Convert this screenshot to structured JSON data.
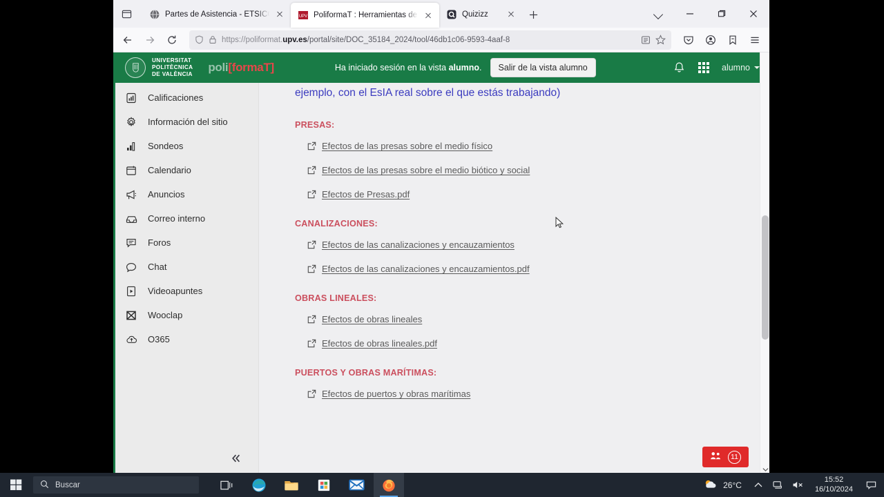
{
  "browser": {
    "tab_list_icon": "tab-list-icon",
    "tabs": [
      {
        "title": "Partes de Asistencia - ETSICCP",
        "favicon": "globe-icon",
        "active": false
      },
      {
        "title": "PoliformaT : Herramientas de e",
        "favicon": "upv-icon",
        "active": true
      },
      {
        "title": "Quizizz",
        "favicon": "quizizz-icon",
        "active": false
      }
    ],
    "new_tab_label": "+",
    "window_controls": {
      "list_all_tabs": "chevron-down-icon",
      "minimize": "—",
      "maximize": "❐",
      "close": "✕"
    },
    "nav": {
      "back": "back-arrow-icon",
      "forward": "forward-arrow-icon",
      "reload": "reload-icon",
      "url_prefix": "https://poliformat.",
      "url_domain": "upv.es",
      "url_path": "/portal/site/DOC_35184_2024/tool/46db1c06-9593-4aaf-8",
      "reader_icon": "reader-view-icon",
      "bookmark_icon": "star-icon",
      "shield_icon": "shield-icon",
      "lock_icon": "lock-icon",
      "pocket_icon": "pocket-icon",
      "account_icon": "account-icon",
      "save_to_pocket_icon": "save-icon",
      "menu_icon": "hamburger-menu-icon"
    }
  },
  "site_header": {
    "university_lines": [
      "UNIVERSITAT",
      "POLITÈCNICA",
      "DE VALÈNCIA"
    ],
    "logo_poli": "poli",
    "logo_format": "[formaT]",
    "session_message_pre": "Ha iniciado sesión en la vista ",
    "session_message_role": "alumno",
    "session_message_post": ".",
    "exit_button": "Salir de la vista alumno",
    "bell_icon": "bell-icon",
    "grid_icon": "app-grid-icon",
    "user_name": "alumno",
    "brand_green": "#197b46",
    "brand_red": "#e8464a"
  },
  "sidebar": {
    "items": [
      {
        "label": "Calificaciones",
        "icon": "grades-chart-icon"
      },
      {
        "label": "Información del sitio",
        "icon": "gear-icon"
      },
      {
        "label": "Sondeos",
        "icon": "bar-chart-icon"
      },
      {
        "label": "Calendario",
        "icon": "calendar-icon"
      },
      {
        "label": "Anuncios",
        "icon": "megaphone-icon"
      },
      {
        "label": "Correo interno",
        "icon": "inbox-icon"
      },
      {
        "label": "Foros",
        "icon": "forum-icon"
      },
      {
        "label": "Chat",
        "icon": "chat-bubble-icon"
      },
      {
        "label": "Videoapuntes",
        "icon": "video-file-icon"
      },
      {
        "label": "Wooclap",
        "icon": "wooclap-icon"
      },
      {
        "label": "O365",
        "icon": "cloud-upload-icon"
      }
    ],
    "collapse_icon": "double-chevron-left-icon"
  },
  "content": {
    "intro_line": "ejemplo, con el EsIA real sobre el que estás trabajando)",
    "sections": [
      {
        "heading": "PRESAS:",
        "links": [
          "Efectos de las presas sobre el medio físico",
          "Efectos de las presas sobre el medio biótico y social",
          "Efectos de Presas.pdf"
        ]
      },
      {
        "heading": "CANALIZACIONES:",
        "links": [
          "Efectos de las canalizaciones y encauzamientos",
          "Efectos de las canalizaciones y encauzamientos.pdf"
        ]
      },
      {
        "heading": "OBRAS LINEALES:",
        "links": [
          "Efectos de obras lineales",
          "Efectos de obras lineales.pdf"
        ]
      },
      {
        "heading": "PUERTOS Y OBRAS MARÍTIMAS:",
        "links": [
          "Efectos de puertos y obras marítimas"
        ]
      }
    ],
    "heading_color": "#cb4f5e",
    "intro_color": "#3b3bbf",
    "external_link_icon": "external-link-icon"
  },
  "participants_badge": {
    "icon": "people-icon",
    "count": "11",
    "color": "#e02a2a"
  },
  "taskbar": {
    "start_icon": "windows-start-icon",
    "search_icon": "search-icon",
    "search_placeholder": "Buscar",
    "pinned": [
      {
        "name": "task-view-icon"
      },
      {
        "name": "edge-icon"
      },
      {
        "name": "file-explorer-icon"
      },
      {
        "name": "microsoft-store-icon"
      },
      {
        "name": "mail-icon"
      },
      {
        "name": "firefox-icon"
      }
    ],
    "tray": {
      "weather_icon": "partly-cloudy-icon",
      "temperature": "26°C",
      "show_hidden_icon": "chevron-up-icon",
      "network_icon": "network-icon",
      "volume_icon": "volume-muted-icon",
      "time": "15:52",
      "date": "16/10/2024",
      "notifications_icon": "notification-icon"
    }
  },
  "cursor": {
    "icon": "mouse-pointer-icon"
  }
}
